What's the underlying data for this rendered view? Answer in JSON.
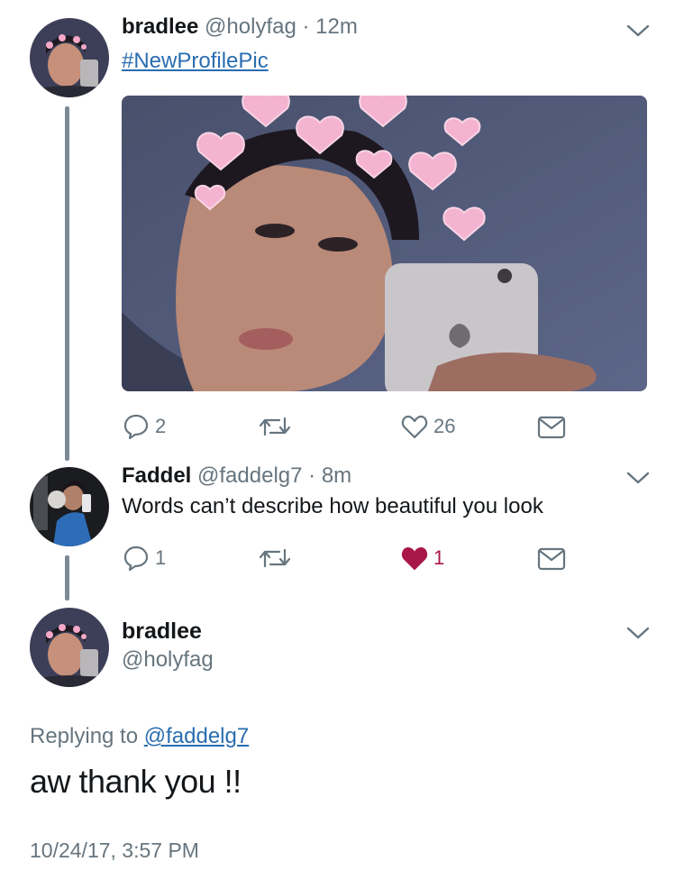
{
  "tweet1": {
    "name": "bradlee",
    "handle": "@holyfag",
    "dot": "·",
    "time": "12m",
    "hashtag": "#NewProfilePic",
    "reply_count": "2",
    "retweet_count": "",
    "like_count": "26"
  },
  "tweet2": {
    "name": "Faddel",
    "handle": "@faddelg7",
    "dot": "·",
    "time": "8m",
    "text": "Words can’t describe how beautiful you look",
    "reply_count": "1",
    "retweet_count": "",
    "like_count": "1",
    "liked": true
  },
  "main_tweet": {
    "name": "bradlee",
    "handle": "@holyfag",
    "replying_prefix": "Replying to ",
    "replying_to": "@faddelg7",
    "text": "aw thank you !!",
    "timestamp": "10/24/17, 3:57 PM"
  },
  "colors": {
    "link": "#2a6db0",
    "muted": "#66757f",
    "like_active": "#a91748",
    "thread_line": "#7d8a96"
  },
  "icons": [
    "reply-icon",
    "retweet-icon",
    "heart-icon",
    "dm-icon",
    "chevron-down-icon"
  ]
}
